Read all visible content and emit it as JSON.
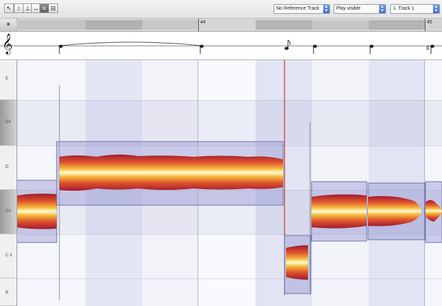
{
  "toolbar": {
    "tools": [
      {
        "icon": "arrow-pointer-icon",
        "glyph": "↖"
      },
      {
        "icon": "pitch-tool-icon",
        "glyph": "↕"
      },
      {
        "icon": "note-separation-icon",
        "glyph": "⊥"
      },
      {
        "icon": "time-tool-icon",
        "glyph": "↔"
      },
      {
        "icon": "amplitude-tool-icon",
        "glyph": "≡"
      },
      {
        "icon": "formant-tool-icon",
        "glyph": "⊟"
      }
    ],
    "reference_track": "No Reference Track",
    "play_mode": "Play visible",
    "track": "1. Track 1"
  },
  "ruler": {
    "corner_icon": "tempo-icon",
    "bars": [
      {
        "label": "44",
        "time": 1.0
      },
      {
        "label": "45",
        "time": 2.0
      }
    ]
  },
  "notation": {
    "clef": "𝄞",
    "clef_icon": "treble-clef-icon"
  },
  "keyboard": {
    "keys": [
      {
        "label": "E",
        "black": false
      },
      {
        "label": "D#",
        "black": true
      },
      {
        "label": "D",
        "black": false
      },
      {
        "label": "C#",
        "black": true
      },
      {
        "label": "C 3",
        "black": false
      },
      {
        "label": "B",
        "black": false
      }
    ]
  },
  "notes": [
    {
      "name": "note-csharp-1",
      "pitch": "C#"
    },
    {
      "name": "note-d-long",
      "pitch": "D"
    },
    {
      "name": "note-c-short",
      "pitch": "C 3"
    },
    {
      "name": "note-csharp-2",
      "pitch": "C#"
    },
    {
      "name": "note-csharp-3",
      "pitch": "C#"
    },
    {
      "name": "note-csharp-4",
      "pitch": "C#"
    }
  ],
  "colors": {
    "blob_core": "#fffbd0",
    "blob_mid": "#f4b33a",
    "blob_outer": "#b8242c",
    "note_box": "#8e91c8",
    "playhead": "#c0392b"
  }
}
